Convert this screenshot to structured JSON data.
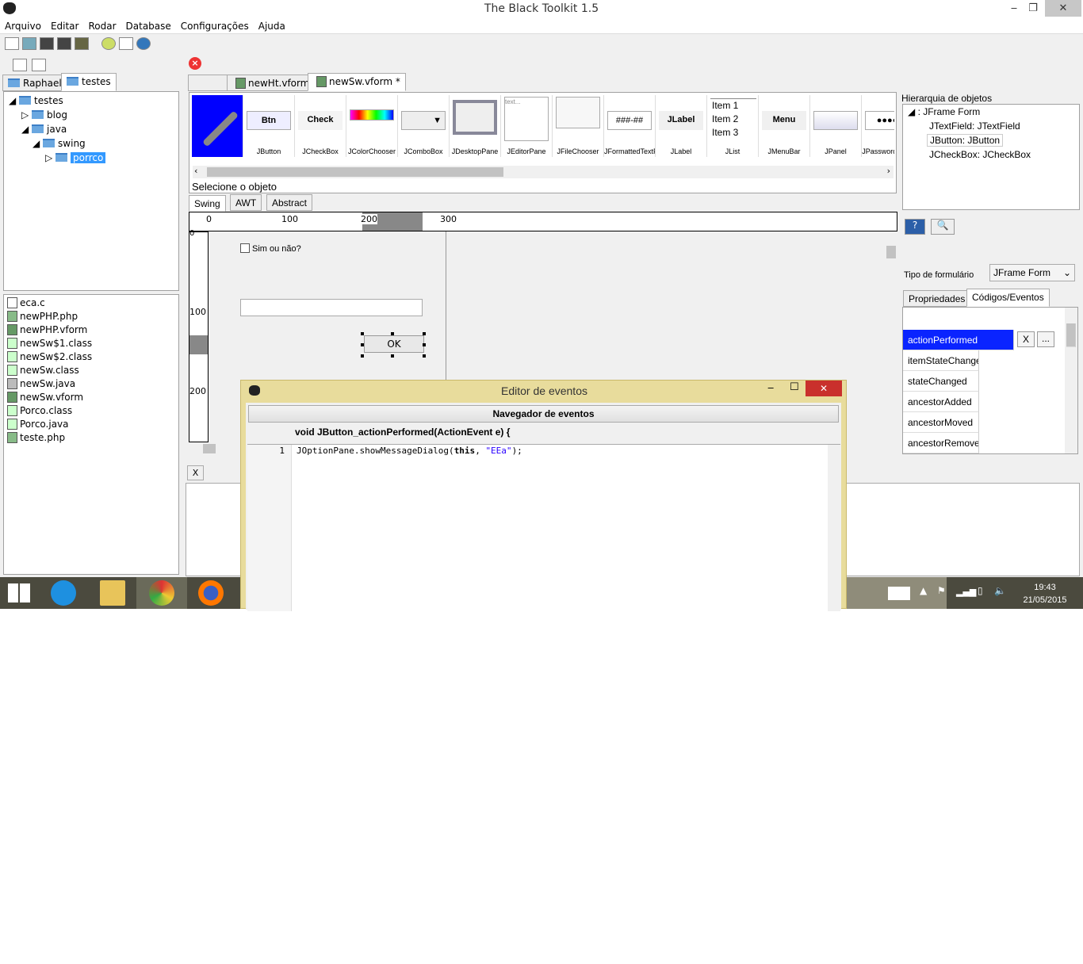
{
  "window": {
    "title": "The Black Toolkit 1.5",
    "minimize": "‒",
    "maximize": "❐",
    "close": "✕"
  },
  "menu": [
    "Arquivo",
    "Editar",
    "Rodar",
    "Database",
    "Configurações",
    "Ajuda"
  ],
  "left": {
    "tabs": [
      "Raphael",
      "testes"
    ],
    "tree": [
      "testes",
      "blog",
      "java",
      "swing",
      "porrco"
    ],
    "files": [
      "eca.c",
      "newPHP.php",
      "newPHP.vform",
      "newSw$1.class",
      "newSw$2.class",
      "newSw.class",
      "newSw.java",
      "newSw.vform",
      "Porco.class",
      "Porco.java",
      "teste.php"
    ]
  },
  "editor": {
    "tabs": [
      "newHt.vform",
      "newSw.vform *"
    ],
    "palette": [
      "JButton",
      "JCheckBox",
      "JColorChooser",
      "JComboBox",
      "JDesktopPane",
      "JEditorPane",
      "JFileChooser",
      "JFormattedTextField",
      "JLabel",
      "JList",
      "JMenuBar",
      "JPanel",
      "JPasswordField"
    ],
    "palette_previews": {
      "button": "Btn",
      "check": "Check",
      "formatted": "###-##",
      "label": "JLabel",
      "list": [
        "Item 1",
        "Item 2",
        "Item 3"
      ],
      "menu": "Menu",
      "editor": "text..."
    },
    "select_label": "Selecione o objeto",
    "category_tabs": [
      "Swing",
      "AWT",
      "Abstract"
    ],
    "ruler_h": [
      "0",
      "100",
      "200",
      "300"
    ],
    "ruler_v": [
      "0",
      "100",
      "200"
    ],
    "form": {
      "checkbox": "Sim ou não?",
      "button": "OK"
    },
    "bottom_close": "X"
  },
  "right": {
    "hierarchy_title": "Hierarquia de objetos",
    "hierarchy": [
      ": JFrame Form",
      "JTextField: JTextField",
      "JButton: JButton",
      "JCheckBox: JCheckBox"
    ],
    "form_type_label": "Tipo de formulário",
    "form_type": "JFrame Form",
    "tabs": [
      "Propriedades",
      "Códigos/Eventos"
    ],
    "events": [
      "actionPerformed",
      "itemStateChanged",
      "stateChanged",
      "ancestorAdded",
      "ancestorMoved",
      "ancestorRemoved"
    ],
    "event_clear": "X",
    "event_more": "..."
  },
  "dialog": {
    "title": "Editor de eventos",
    "header": "Navegador de eventos",
    "signature": "void JButton_actionPerformed(ActionEvent e) {",
    "line_no": "1",
    "code": {
      "pre": "JOptionPane.showMessageDialog(",
      "kw": "this",
      "mid": ", ",
      "str": "\"EEa\"",
      "post": ");"
    }
  },
  "taskbar": {
    "time": "19:43",
    "date": "21/05/2015"
  },
  "colors": {
    "selection": "#0a24ff",
    "taskbar": "#4b4a3e",
    "dialog_frame": "#e8dc9c",
    "close_red": "#e81123"
  }
}
